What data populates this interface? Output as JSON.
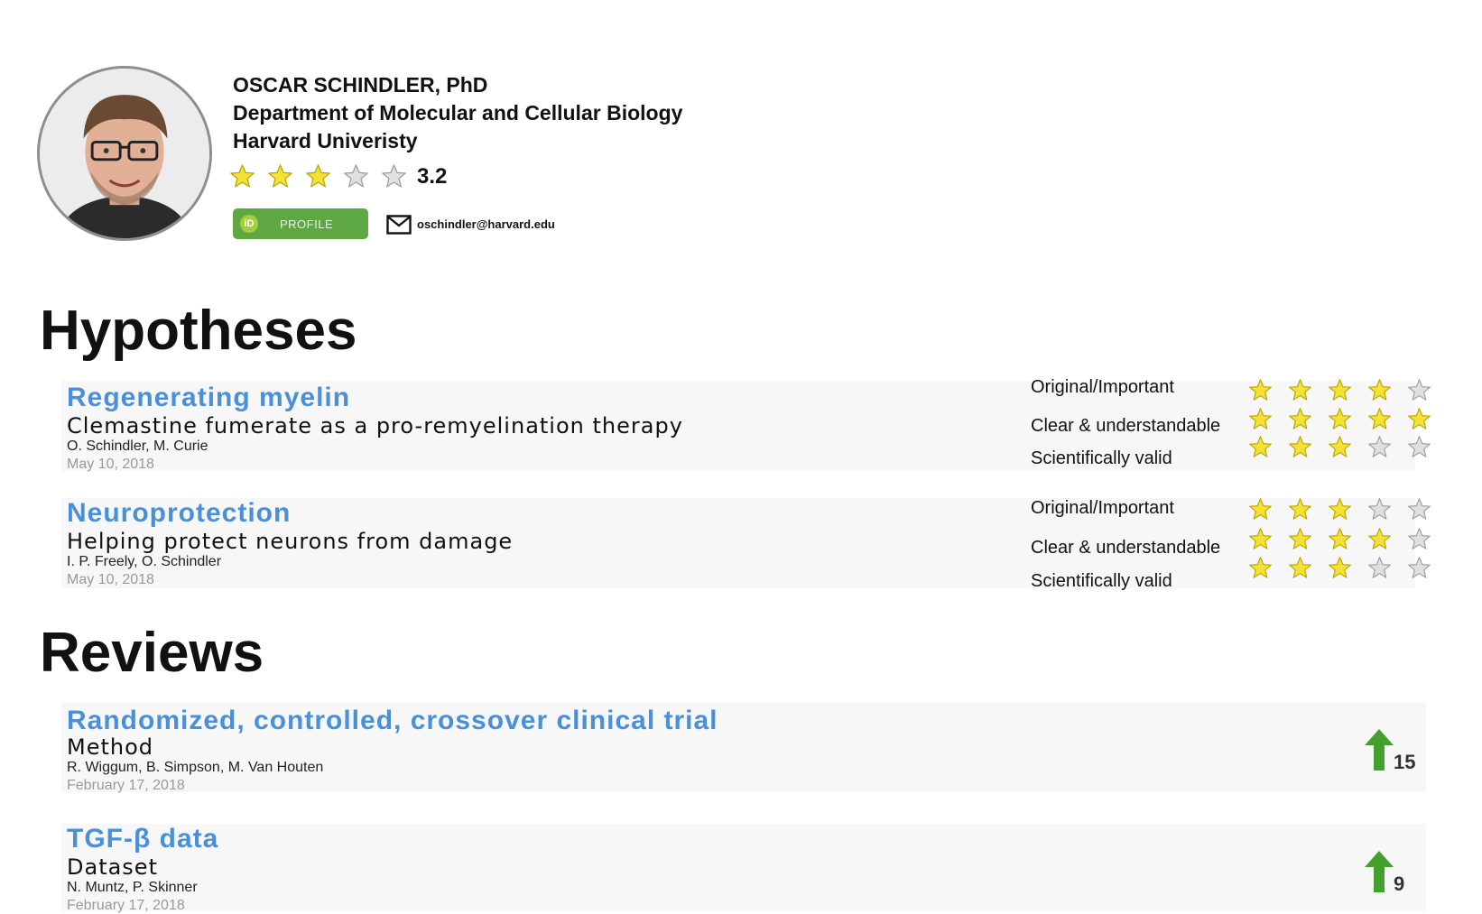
{
  "colors": {
    "accent": "#4a90d9",
    "star_on": "#f3e233",
    "star_off": "#e0e0e0",
    "orcid_green": "#5ea843",
    "vote_green": "#43a02c"
  },
  "profile": {
    "name": "OSCAR SCHINDLER, PhD",
    "department": "Department of Molecular and Cellular Biology",
    "institution": "Harvard Univeristy",
    "rating": 3.2,
    "rating_label": "3.2",
    "rating_stars": 3,
    "orcid_badge": "iD",
    "orcid_label": "PROFILE",
    "email": "oschindler@harvard.edu",
    "icons": {
      "email": "mail-icon",
      "orcid": "orcid-icon"
    }
  },
  "hypotheses": {
    "heading": "Hypotheses",
    "items": [
      {
        "title": "Regenerating myelin",
        "subtitle": "Clemastine fumerate as a pro-remyelination therapy",
        "authors": "O. Schindler, M. Curie",
        "date": "May 10, 2018",
        "ratings": [
          {
            "label": "Original/Important",
            "stars": 4
          },
          {
            "label": "Clear & understandable",
            "stars": 5
          },
          {
            "label": "Scientifically valid",
            "stars": 3
          }
        ]
      },
      {
        "title": "Neuroprotection",
        "subtitle": "Helping protect neurons from damage",
        "authors": "I. P. Freely, O. Schindler",
        "date": "May 10, 2018",
        "ratings": [
          {
            "label": "Original/Important",
            "stars": 3
          },
          {
            "label": "Clear & understandable",
            "stars": 4
          },
          {
            "label": "Scientifically valid",
            "stars": 3
          }
        ]
      }
    ]
  },
  "reviews": {
    "heading": "Reviews",
    "items": [
      {
        "title": "Randomized, controlled, crossover clinical trial",
        "type": "Method",
        "authors": "R. Wiggum, B. Simpson, M. Van Houten",
        "date": "February 17, 2018",
        "votes": "15"
      },
      {
        "title": "TGF-β data",
        "type": "Dataset",
        "authors": "N. Muntz, P. Skinner",
        "date": "February 17, 2018",
        "votes": "9"
      }
    ]
  }
}
